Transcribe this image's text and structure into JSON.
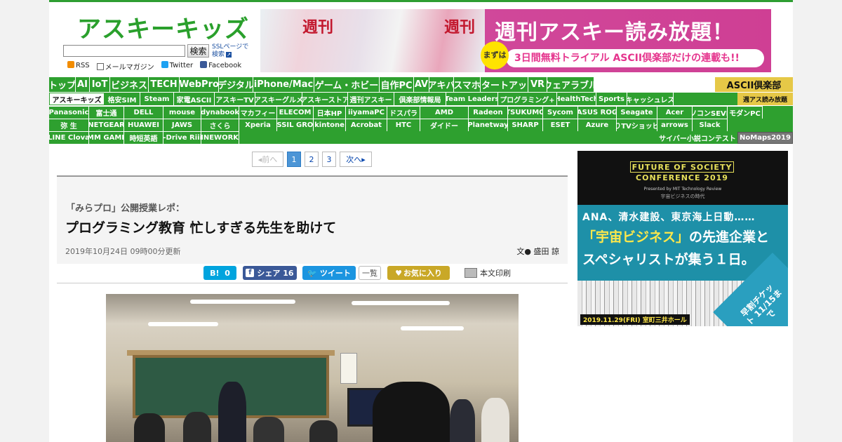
{
  "header": {
    "logo": "アスキーキッズ",
    "search_button": "検索",
    "ssl_link": "SSLページで検索",
    "social": [
      "RSS",
      "メールマガジン",
      "Twitter",
      "Facebook"
    ]
  },
  "banner": {
    "mag_title": "週刊",
    "title": "週刊アスキー読み放題！",
    "badge": "まずは",
    "sub": "3日間無料トライアル ASCII倶楽部だけの連載も!!"
  },
  "nav": {
    "row1": [
      "トップ",
      "AI",
      "IoT",
      "ビジネス",
      "TECH",
      "WebPro",
      "デジタル",
      "iPhone/Mac",
      "ゲーム・ホビー",
      "自作PC",
      "AV",
      "アキバ",
      "スマホ",
      "スタートアップ",
      "VR",
      "ウェアラブル"
    ],
    "club": "ASCII倶楽部",
    "row2": [
      "アスキーキッズ",
      "格安SIM",
      "Steam",
      "家電ASCII",
      "アスキーTV",
      "アスキーグルメ",
      "アスキーストア",
      "週刊アスキー",
      "倶楽部情報局",
      "Team Leaders",
      "プログラミング+",
      "HealthTech",
      "Sports",
      "キャッシュレス"
    ],
    "weekly": "週アス読み放題",
    "row3": [
      "Panasonic",
      "富士通",
      "DELL",
      "mouse",
      "dynabook",
      "マカフィー",
      "ELECOM",
      "日本HP",
      "iiyamaPC",
      "ドスパラ",
      "AMD",
      "Radeon",
      "TSUKUMO",
      "Sycom",
      "ASUS ROG",
      "Seagate",
      "Acer",
      "パソコンSEVEN",
      "モダンPC"
    ],
    "row4": [
      "弥 生",
      "NETGEAR",
      "HUAWEI",
      "JAWS",
      "さくら",
      "Xperia",
      "FOSSIL GROUP",
      "kintone",
      "Acrobat",
      "HTC",
      "ダイドー",
      "Planetway",
      "SHARP",
      "ESET",
      "Azure",
      "ひかりTVショッピング",
      "arrows",
      "Slack"
    ],
    "row5": [
      "LINE Clova",
      "DMM GAMES",
      "時短英語",
      "Eco-Drive Riiiver",
      "LINEWORKS"
    ],
    "cyber": "サイバー小説コンテスト",
    "nomaps": "NoMaps2019"
  },
  "pager": {
    "prev": "前へ",
    "pages": [
      "1",
      "2",
      "3"
    ],
    "current": "1",
    "next": "次へ"
  },
  "article": {
    "kicker": "「みらプロ」公開授業レポ：",
    "title": "プログラミング教育 忙しすぎる先生を助けて",
    "date": "2019年10月24日 09時00分更新",
    "author": "文● 盛田 諒"
  },
  "share": {
    "hatena_label": "B!",
    "hatena_count": "0",
    "fb_label": "シェア",
    "fb_count": "16",
    "tweet_label": "ツイート",
    "list_label": "一覧",
    "fav_label": "お気に入り",
    "print_label": "本文印刷"
  },
  "side_ad": {
    "title1": "FUTURE OF SOCIETY",
    "title2": "CONFERENCE 2019",
    "presented": "Presented by MIT Technology Review",
    "era": "宇宙ビジネスの時代",
    "line1": "ANA、清水建設、東京海上日動……",
    "line2_highlight": "「宇宙ビジネス」",
    "line2_rest": "の先進企業と",
    "line3": "スペシャリストが集う１日。",
    "date": "2019.11.29(FRI) 室町三井ホール",
    "ticket": "早割チケット 11/15まで"
  }
}
